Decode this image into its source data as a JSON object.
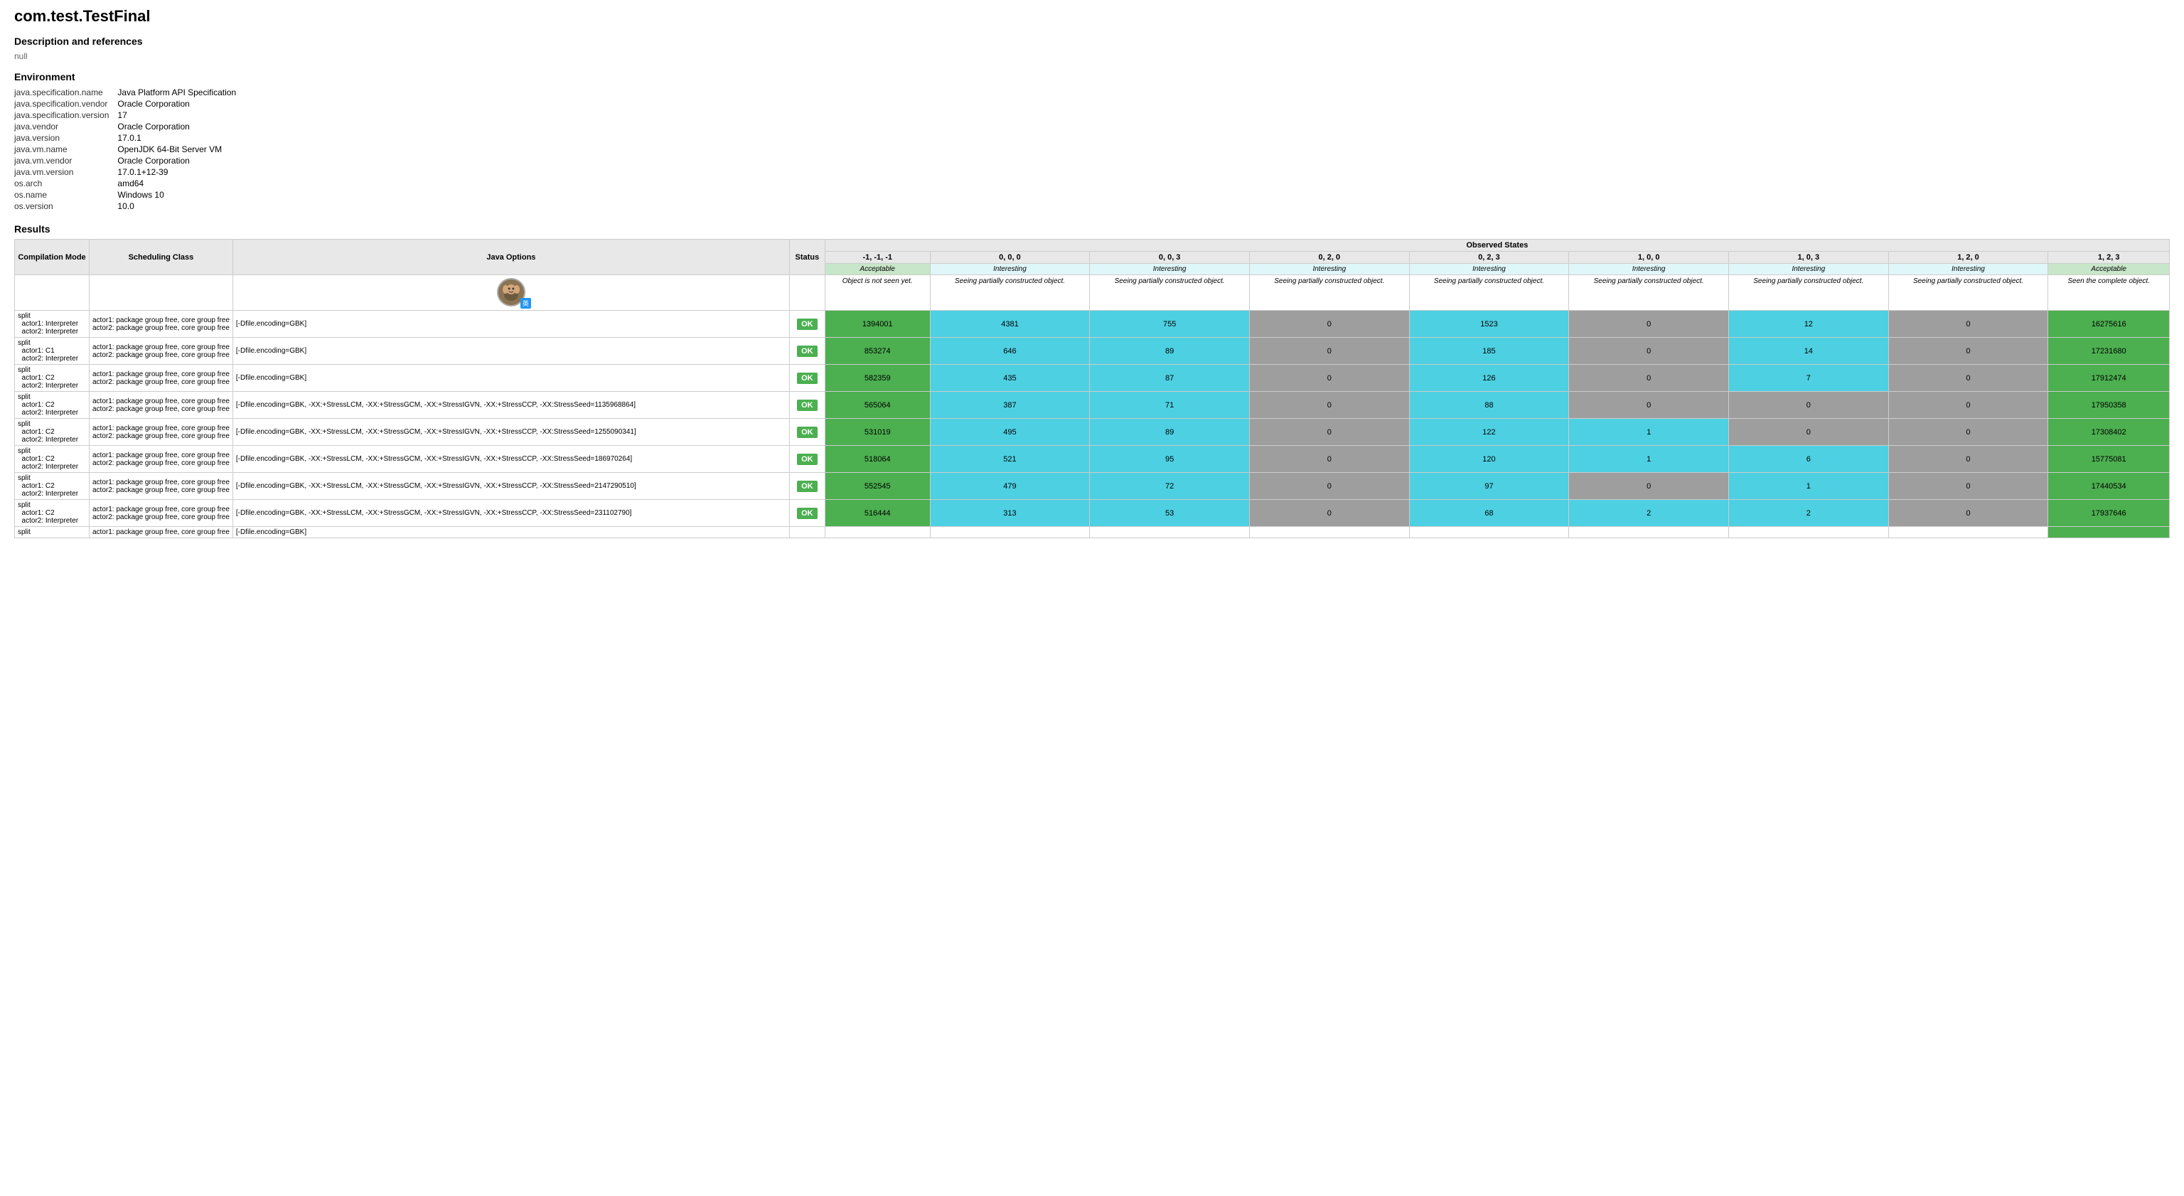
{
  "page": {
    "title": "com.test.TestFinal",
    "description_heading": "Description and references",
    "description_value": "null",
    "environment_heading": "Environment",
    "results_heading": "Results"
  },
  "environment": [
    {
      "key": "java.specification.name",
      "value": "Java Platform API Specification"
    },
    {
      "key": "java.specification.vendor",
      "value": "Oracle Corporation"
    },
    {
      "key": "java.specification.version",
      "value": "17"
    },
    {
      "key": "java.vendor",
      "value": "Oracle Corporation"
    },
    {
      "key": "java.version",
      "value": "17.0.1"
    },
    {
      "key": "java.vm.name",
      "value": "OpenJDK 64-Bit Server VM"
    },
    {
      "key": "java.vm.vendor",
      "value": "Oracle Corporation"
    },
    {
      "key": "java.vm.version",
      "value": "17.0.1+12-39"
    },
    {
      "key": "os.arch",
      "value": "amd64"
    },
    {
      "key": "os.name",
      "value": "Windows 10"
    },
    {
      "key": "os.version",
      "value": "10.0"
    }
  ],
  "table": {
    "headers": {
      "compilation_mode": "Compilation Mode",
      "scheduling_class": "Scheduling Class",
      "java_options": "Java Options",
      "status": "Status",
      "observed_states": "Observed States"
    },
    "observed_cols": [
      "-1, -1, -1",
      "0, 0, 0",
      "0, 0, 3",
      "0, 2, 0",
      "0, 2, 3",
      "1, 0, 0",
      "1, 0, 3",
      "1, 2, 0",
      "1, 2, 3"
    ],
    "observed_types": [
      "Acceptable",
      "Interesting",
      "Interesting",
      "Interesting",
      "Interesting",
      "Interesting",
      "Interesting",
      "Interesting",
      "Acceptable"
    ],
    "observed_descs": [
      "Object is not seen yet.",
      "Seeing partially constructed object.",
      "Seeing partially constructed object.",
      "Seeing partially constructed object.",
      "Seeing partially constructed object.",
      "Seeing partially constructed object.",
      "Seeing partially constructed object.",
      "Seeing partially constructed object.",
      "Seen the complete object."
    ],
    "rows": [
      {
        "compilation": "split\n  actor1: Interpreter\n  actor2: Interpreter",
        "scheduling": "actor1: package group free, core group free\nactor2: package group free, core group free",
        "java_options": "[-Dfile.encoding=GBK]",
        "status": "OK",
        "cells": [
          "1394001",
          "4381",
          "755",
          "0",
          "1523",
          "0",
          "12",
          "0",
          "16275616"
        ],
        "cell_styles": [
          "green",
          "cyan",
          "cyan",
          "gray",
          "cyan",
          "gray",
          "cyan",
          "gray",
          "green"
        ]
      },
      {
        "compilation": "split\n  actor1: C1\n  actor2: Interpreter",
        "scheduling": "actor1: package group free, core group free\nactor2: package group free, core group free",
        "java_options": "[-Dfile.encoding=GBK]",
        "status": "OK",
        "cells": [
          "853274",
          "646",
          "89",
          "0",
          "185",
          "0",
          "14",
          "0",
          "17231680"
        ],
        "cell_styles": [
          "green",
          "cyan",
          "cyan",
          "gray",
          "cyan",
          "gray",
          "cyan",
          "gray",
          "green"
        ]
      },
      {
        "compilation": "split\n  actor1: C2\n  actor2: Interpreter",
        "scheduling": "actor1: package group free, core group free\nactor2: package group free, core group free",
        "java_options": "[-Dfile.encoding=GBK]",
        "status": "OK",
        "cells": [
          "582359",
          "435",
          "87",
          "0",
          "126",
          "0",
          "7",
          "0",
          "17912474"
        ],
        "cell_styles": [
          "green",
          "cyan",
          "cyan",
          "gray",
          "cyan",
          "gray",
          "cyan",
          "gray",
          "green"
        ]
      },
      {
        "compilation": "split\n  actor1: C2\n  actor2: Interpreter",
        "scheduling": "actor1: package group free, core group free\nactor2: package group free, core group free",
        "java_options": "[-Dfile.encoding=GBK, -XX:+StressLCM, -XX:+StressGCM, -XX:+StressIGVN, -XX:+StressCCP, -XX:StressSeed=1135968864]",
        "status": "OK",
        "cells": [
          "565064",
          "387",
          "71",
          "0",
          "88",
          "0",
          "0",
          "0",
          "17950358"
        ],
        "cell_styles": [
          "green",
          "cyan",
          "cyan",
          "gray",
          "cyan",
          "gray",
          "gray",
          "gray",
          "green"
        ]
      },
      {
        "compilation": "split\n  actor1: C2\n  actor2: Interpreter",
        "scheduling": "actor1: package group free, core group free\nactor2: package group free, core group free",
        "java_options": "[-Dfile.encoding=GBK, -XX:+StressLCM, -XX:+StressGCM, -XX:+StressIGVN, -XX:+StressCCP, -XX:StressSeed=1255090341]",
        "status": "OK",
        "cells": [
          "531019",
          "495",
          "89",
          "0",
          "122",
          "1",
          "0",
          "0",
          "17308402"
        ],
        "cell_styles": [
          "green",
          "cyan",
          "cyan",
          "gray",
          "cyan",
          "cyan",
          "gray",
          "gray",
          "green"
        ]
      },
      {
        "compilation": "split\n  actor1: C2\n  actor2: Interpreter",
        "scheduling": "actor1: package group free, core group free\nactor2: package group free, core group free",
        "java_options": "[-Dfile.encoding=GBK, -XX:+StressLCM, -XX:+StressGCM, -XX:+StressIGVN, -XX:+StressCCP, -XX:StressSeed=186970264]",
        "status": "OK",
        "cells": [
          "518064",
          "521",
          "95",
          "0",
          "120",
          "1",
          "6",
          "0",
          "15775081"
        ],
        "cell_styles": [
          "green",
          "cyan",
          "cyan",
          "gray",
          "cyan",
          "cyan",
          "cyan",
          "gray",
          "green"
        ]
      },
      {
        "compilation": "split\n  actor1: C2\n  actor2: Interpreter",
        "scheduling": "actor1: package group free, core group free\nactor2: package group free, core group free",
        "java_options": "[-Dfile.encoding=GBK, -XX:+StressLCM, -XX:+StressGCM, -XX:+StressIGVN, -XX:+StressCCP, -XX:StressSeed=2147290510]",
        "status": "OK",
        "cells": [
          "552545",
          "479",
          "72",
          "0",
          "97",
          "0",
          "1",
          "0",
          "17440534"
        ],
        "cell_styles": [
          "green",
          "cyan",
          "cyan",
          "gray",
          "cyan",
          "gray",
          "cyan",
          "gray",
          "green"
        ]
      },
      {
        "compilation": "split\n  actor1: C2\n  actor2: Interpreter",
        "scheduling": "actor1: package group free, core group free\nactor2: package group free, core group free",
        "java_options": "[-Dfile.encoding=GBK, -XX:+StressLCM, -XX:+StressGCM, -XX:+StressIGVN, -XX:+StressCCP, -XX:StressSeed=231102790]",
        "status": "OK",
        "cells": [
          "516444",
          "313",
          "53",
          "0",
          "68",
          "2",
          "2",
          "0",
          "17937646"
        ],
        "cell_styles": [
          "green",
          "cyan",
          "cyan",
          "gray",
          "cyan",
          "cyan",
          "cyan",
          "gray",
          "green"
        ]
      },
      {
        "compilation": "split",
        "scheduling": "actor1: package group free, core group free",
        "java_options": "[-Dfile.encoding=GBK]",
        "status": "",
        "cells": [
          "",
          "",
          "",
          "",
          "",
          "",
          "",
          "",
          ""
        ],
        "cell_styles": [
          "light",
          "light",
          "light",
          "light",
          "light",
          "light",
          "light",
          "light",
          "green"
        ]
      }
    ]
  }
}
